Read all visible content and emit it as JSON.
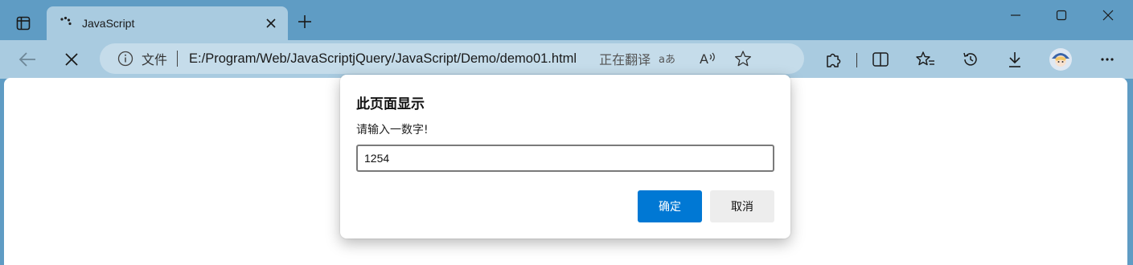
{
  "window": {
    "accent_color": "#5f9cc4",
    "toolbar_color": "#a9cbe0"
  },
  "tab": {
    "title": "JavaScript",
    "favicon": "loading-spinner-icon"
  },
  "addressbar": {
    "scheme_label": "文件",
    "url": "E:/Program/Web/JavaScriptjQuery/JavaScript/Demo/demo01.html",
    "translating_label": "正在翻译"
  },
  "dialog": {
    "title": "此页面显示",
    "message": "请输入一数字!",
    "input_value": "1254",
    "ok_label": "确定",
    "cancel_label": "取消",
    "ok_color": "#0078d4"
  }
}
